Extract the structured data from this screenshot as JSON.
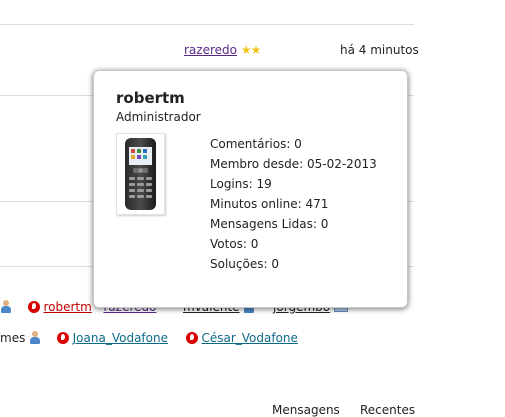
{
  "top_row": {
    "username": "razeredo",
    "time": "há 4 minutos",
    "stars": "★★"
  },
  "popup": {
    "name": "robertm",
    "role": "Administrador",
    "stats": [
      "Comentários: 0",
      "Membro desde: 05-02-2013",
      "Logins: 19",
      "Minutos online: 471",
      "Mensagens Lidas: 0",
      "Votos: 0",
      "Soluções: 0"
    ]
  },
  "users_row1": {
    "user_a": "robertm",
    "user_b": "razeredo",
    "user_c": "mvalente",
    "user_d": "jorgembo"
  },
  "users_row2": {
    "prefix_partial": "mes",
    "user_a": "Joana_Vodafone",
    "user_b": "César_Vodafone"
  },
  "tabs": {
    "tab1": "Mensagens",
    "tab2": "Recentes"
  },
  "colors": {
    "username_link": "#5a2a88",
    "red_link": "#c40000",
    "teal_link": "#0d6b8a",
    "vodafone_red": "#d90000",
    "star": "#f2c51b"
  },
  "icons": [
    "star-icon",
    "vodafone-icon",
    "user-icon",
    "message-icon"
  ]
}
